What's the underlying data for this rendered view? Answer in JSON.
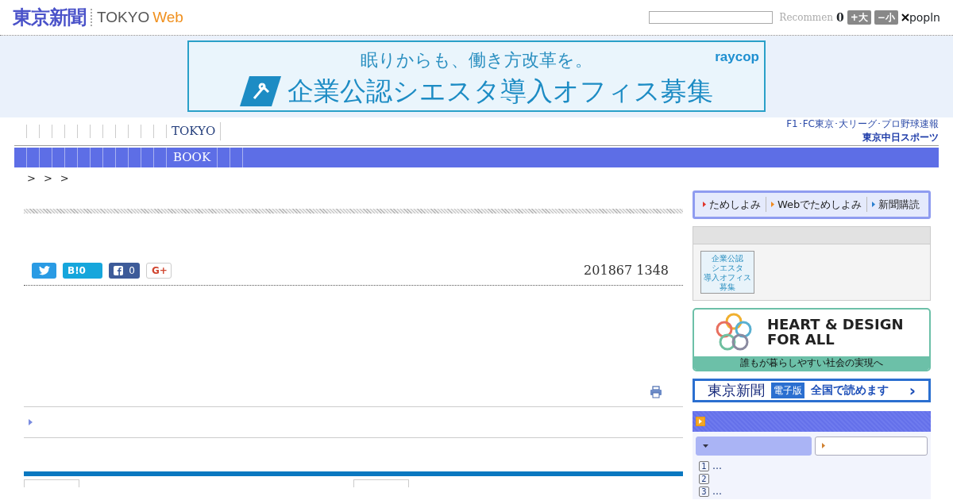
{
  "header": {
    "logo_kanji": "東京新聞",
    "logo_tokyo": "TOKYO",
    "logo_web": "Web",
    "recommend": "Recommen",
    "count": "0",
    "size_buttons": [
      "+大",
      "−小"
    ],
    "popln": "popln"
  },
  "ad_banner": {
    "headline": "眠りからも、働き方改革を。",
    "main": "企業公認シエスタ導入オフィス募集",
    "brand": "raycop"
  },
  "nav": {
    "label": "TOKYO",
    "sports_text": "F1･FC東京･大リーグ･プロ野球速報",
    "sports_logo": "東京中日スポーツ"
  },
  "category_bar": {
    "label": "BOOK"
  },
  "breadcrumb": [
    ">",
    ">",
    ">"
  ],
  "article": {
    "share": [
      {
        "kind": "twitter"
      },
      {
        "kind": "hatena",
        "label": "B!",
        "count": "0"
      },
      {
        "kind": "facebook",
        "count": "0"
      },
      {
        "kind": "google",
        "label": "G+"
      }
    ],
    "date": "201867 1348"
  },
  "subscribe": [
    "ためしよみ",
    "Webでためしよみ",
    "新聞購読"
  ],
  "side_ad": {
    "line1": "企業公認",
    "line2": "シエスタ",
    "line3": "導入オフィス",
    "line4": "募集"
  },
  "heart_banner": {
    "title1": "HEART & DESIGN",
    "title2": "FOR ALL",
    "tagline": "誰もが暮らしやすい社会の実現へ"
  },
  "digital_banner": {
    "name": "東京新聞",
    "badge": "電子版",
    "text": "全国で読めます",
    "arrow": "›"
  },
  "ranking": {
    "tabs": [
      {
        "selected": true
      },
      {
        "selected": false
      }
    ],
    "items": [
      {
        "num": "1",
        "text": "…"
      },
      {
        "num": "2"
      },
      {
        "num": "3",
        "text": "…"
      }
    ]
  }
}
